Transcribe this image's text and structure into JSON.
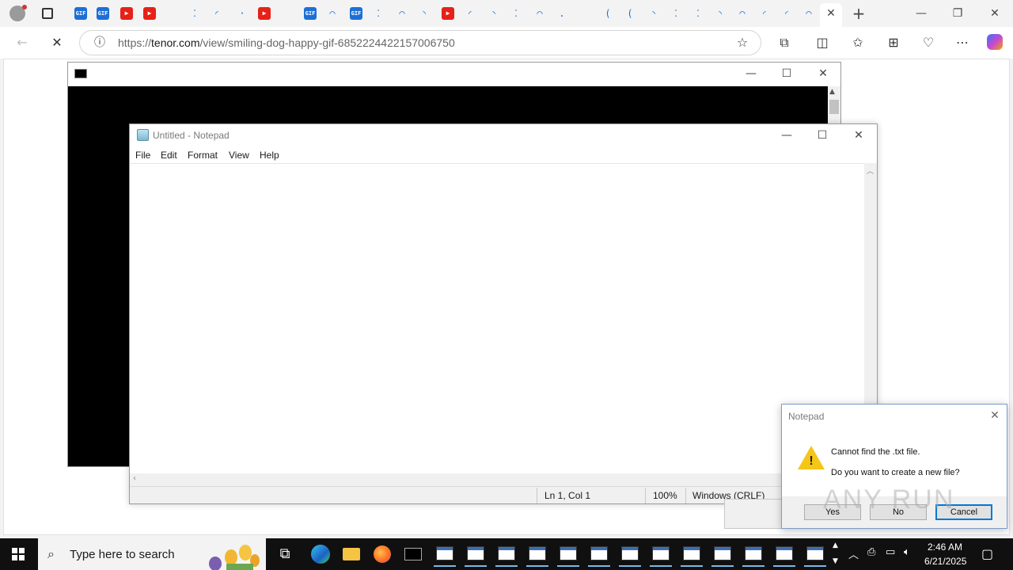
{
  "browser": {
    "url_host": "tenor.com",
    "url_path": "/view/smiling-dog-happy-gif-6852224422157006750",
    "url_scheme": "https://",
    "tabs": [
      {
        "icon": "profile-avatar-icon"
      },
      {
        "icon": "tab-actions-icon"
      },
      {
        "icon": "gif-icon"
      },
      {
        "icon": "gif-icon"
      },
      {
        "icon": "youtube-icon"
      },
      {
        "icon": "youtube-icon"
      },
      {
        "icon": "loading-icon"
      },
      {
        "icon": "loading-icon"
      },
      {
        "icon": "loading-icon"
      },
      {
        "icon": "loading-icon"
      },
      {
        "icon": "youtube-icon"
      },
      {
        "icon": "gif-icon"
      },
      {
        "icon": "loading-icon"
      },
      {
        "icon": "gif-icon"
      }
    ]
  },
  "console": {
    "title_icon": "cmd-icon"
  },
  "notepad": {
    "title": "Untitled - Notepad",
    "menu": [
      "File",
      "Edit",
      "Format",
      "View",
      "Help"
    ],
    "status": {
      "position": "Ln 1, Col 1",
      "zoom": "100%",
      "line_ending": "Windows (CRLF)"
    }
  },
  "dialog": {
    "title": "Notepad",
    "message_line1": "Cannot find the .txt file.",
    "message_line2": "Do you want to create a new file?",
    "buttons": {
      "yes": "Yes",
      "no": "No",
      "cancel": "Cancel"
    }
  },
  "watermark": "ANY RUN",
  "taskbar": {
    "search_placeholder": "Type here to search",
    "time": "2:46 AM",
    "date": "6/21/2025"
  },
  "colors": {
    "accent": "#0078d7",
    "taskbar": "#101010",
    "warning": "#f5c518"
  }
}
